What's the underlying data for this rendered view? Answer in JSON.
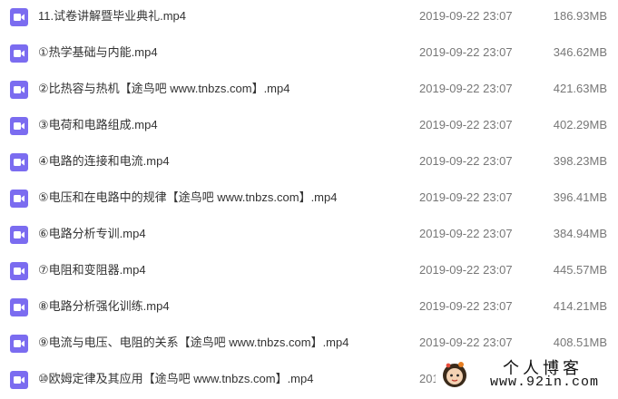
{
  "colors": {
    "icon_purple": "#7b6cf0",
    "text_primary": "#333333",
    "text_secondary": "#777777"
  },
  "files": [
    {
      "name": "11.试卷讲解暨毕业典礼.mp4",
      "date": "2019-09-22 23:07",
      "size": "186.93MB",
      "icon": "video-file-icon"
    },
    {
      "name": "①热学基础与内能.mp4",
      "date": "2019-09-22 23:07",
      "size": "346.62MB",
      "icon": "video-file-icon"
    },
    {
      "name": "②比热容与热机【途鸟吧 www.tnbzs.com】.mp4",
      "date": "2019-09-22 23:07",
      "size": "421.63MB",
      "icon": "video-file-icon"
    },
    {
      "name": "③电荷和电路组成.mp4",
      "date": "2019-09-22 23:07",
      "size": "402.29MB",
      "icon": "video-file-icon"
    },
    {
      "name": "④电路的连接和电流.mp4",
      "date": "2019-09-22 23:07",
      "size": "398.23MB",
      "icon": "video-file-icon"
    },
    {
      "name": "⑤电压和在电路中的规律【途鸟吧 www.tnbzs.com】.mp4",
      "date": "2019-09-22 23:07",
      "size": "396.41MB",
      "icon": "video-file-icon"
    },
    {
      "name": "⑥电路分析专训.mp4",
      "date": "2019-09-22 23:07",
      "size": "384.94MB",
      "icon": "video-file-icon"
    },
    {
      "name": "⑦电阻和变阻器.mp4",
      "date": "2019-09-22 23:07",
      "size": "445.57MB",
      "icon": "video-file-icon"
    },
    {
      "name": "⑧电路分析强化训练.mp4",
      "date": "2019-09-22 23:07",
      "size": "414.21MB",
      "icon": "video-file-icon"
    },
    {
      "name": "⑨电流与电压、电阻的关系【途鸟吧 www.tnbzs.com】.mp4",
      "date": "2019-09-22 23:07",
      "size": "408.51MB",
      "icon": "video-file-icon"
    },
    {
      "name": "⑩欧姆定律及其应用【途鸟吧 www.tnbzs.com】.mp4",
      "date": "201",
      "size": "",
      "icon": "video-file-icon"
    }
  ],
  "watermark": {
    "title": "个人博客",
    "url": "www.92in.com"
  }
}
